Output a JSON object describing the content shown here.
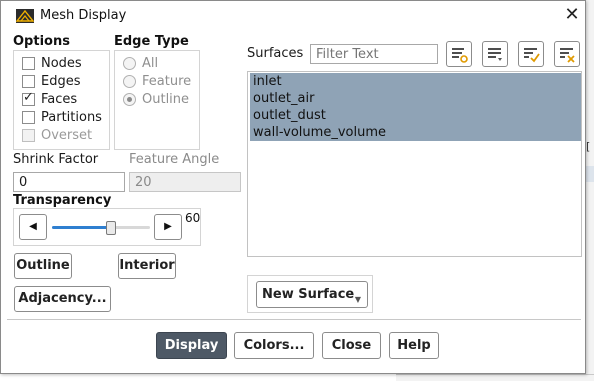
{
  "window": {
    "title": "Mesh Display"
  },
  "options": {
    "title": "Options",
    "items": [
      {
        "label": "Nodes",
        "checked": false,
        "disabled": false
      },
      {
        "label": "Edges",
        "checked": false,
        "disabled": false
      },
      {
        "label": "Faces",
        "checked": true,
        "disabled": false
      },
      {
        "label": "Partitions",
        "checked": false,
        "disabled": false
      },
      {
        "label": "Overset",
        "checked": false,
        "disabled": true
      }
    ]
  },
  "edge_type": {
    "title": "Edge Type",
    "items": [
      {
        "label": "All",
        "selected": false
      },
      {
        "label": "Feature",
        "selected": false
      },
      {
        "label": "Outline",
        "selected": true
      }
    ]
  },
  "shrink_factor": {
    "label": "Shrink Factor",
    "value": "0"
  },
  "feature_angle": {
    "label": "Feature Angle",
    "value": "20"
  },
  "transparency": {
    "title": "Transparency",
    "value": "60",
    "level_percent": 60
  },
  "buttons": {
    "outline": "Outline",
    "interior": "Interior",
    "adjacency": "Adjacency...",
    "new_surface": "New Surface",
    "display": "Display",
    "colors": "Colors...",
    "close": "Close",
    "help": "Help"
  },
  "surfaces": {
    "label": "Surfaces",
    "filter_placeholder": "Filter Text",
    "items": [
      "inlet",
      "outlet_air",
      "outlet_dust",
      "wall-volume_volume"
    ]
  },
  "colors": {
    "primary_button": "#4e5966",
    "selection": "#8fa3b6",
    "slider_fill": "#2f7fd0"
  }
}
